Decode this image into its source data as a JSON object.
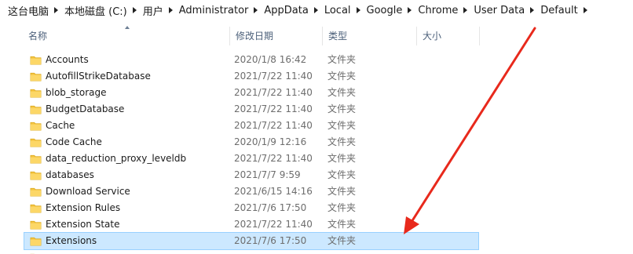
{
  "breadcrumb": {
    "items": [
      {
        "label": "这台电脑"
      },
      {
        "label": "本地磁盘 (C:)"
      },
      {
        "label": "用户"
      },
      {
        "label": "Administrator"
      },
      {
        "label": "AppData"
      },
      {
        "label": "Local"
      },
      {
        "label": "Google"
      },
      {
        "label": "Chrome"
      },
      {
        "label": "User Data"
      },
      {
        "label": "Default"
      }
    ]
  },
  "columns": {
    "name": "名称",
    "date": "修改日期",
    "type": "类型",
    "size": "大小"
  },
  "files": [
    {
      "name": "Accounts",
      "date": "2020/1/8 16:42",
      "type": "文件夹"
    },
    {
      "name": "AutofillStrikeDatabase",
      "date": "2021/7/22 11:40",
      "type": "文件夹"
    },
    {
      "name": "blob_storage",
      "date": "2021/7/22 11:40",
      "type": "文件夹"
    },
    {
      "name": "BudgetDatabase",
      "date": "2021/7/22 11:40",
      "type": "文件夹"
    },
    {
      "name": "Cache",
      "date": "2021/7/22 11:40",
      "type": "文件夹"
    },
    {
      "name": "Code Cache",
      "date": "2020/1/9 12:16",
      "type": "文件夹"
    },
    {
      "name": "data_reduction_proxy_leveldb",
      "date": "2021/7/22 11:40",
      "type": "文件夹"
    },
    {
      "name": "databases",
      "date": "2021/7/7 9:59",
      "type": "文件夹"
    },
    {
      "name": "Download Service",
      "date": "2021/6/15 14:16",
      "type": "文件夹"
    },
    {
      "name": "Extension Rules",
      "date": "2021/7/6 17:50",
      "type": "文件夹"
    },
    {
      "name": "Extension State",
      "date": "2021/7/22 11:40",
      "type": "文件夹"
    },
    {
      "name": "Extensions",
      "date": "2021/7/6 17:50",
      "type": "文件夹"
    }
  ],
  "selected_file": "Extensions",
  "colors": {
    "selection_bg": "#cce8ff",
    "selection_border": "#99d1ff",
    "folder": "#f5c542",
    "annotation_arrow": "#e8291c"
  },
  "icons": {
    "folder": "folder-icon",
    "separator": "chevron-right-icon",
    "sort": "sort-ascending-icon"
  }
}
